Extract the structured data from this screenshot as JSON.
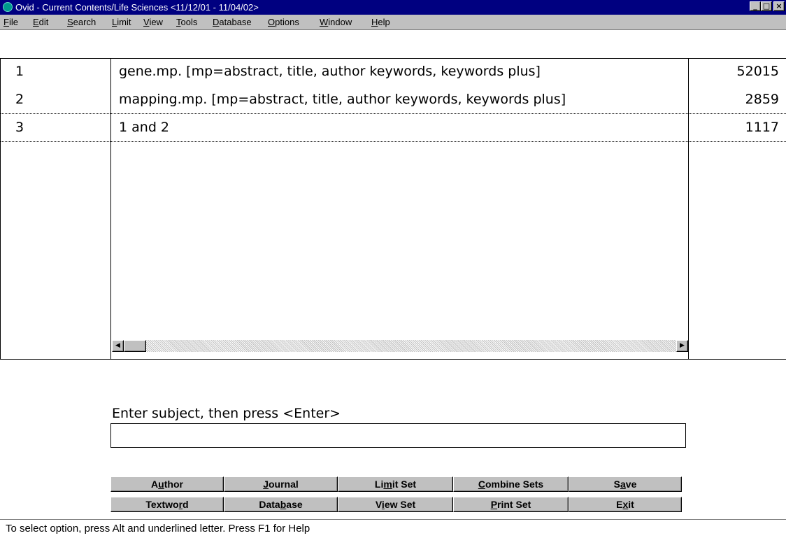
{
  "window": {
    "title": "Ovid - Current Contents/Life Sciences <11/12/01 - 11/04/02>",
    "minimize": "_",
    "maximize": "□",
    "close": "×"
  },
  "menu": [
    {
      "pre": "",
      "u": "F",
      "post": "ile"
    },
    {
      "pre": "",
      "u": "E",
      "post": "dit"
    },
    {
      "pre": "",
      "u": "S",
      "post": "earch"
    },
    {
      "pre": "",
      "u": "L",
      "post": "imit"
    },
    {
      "pre": "",
      "u": "V",
      "post": "iew"
    },
    {
      "pre": "",
      "u": "T",
      "post": "ools"
    },
    {
      "pre": "",
      "u": "D",
      "post": "atabase"
    },
    {
      "pre": "",
      "u": "O",
      "post": "ptions"
    },
    {
      "pre": "",
      "u": "W",
      "post": "indow"
    },
    {
      "pre": "",
      "u": "H",
      "post": "elp"
    }
  ],
  "history": [
    {
      "num": "1",
      "query": "gene.mp. [mp=abstract, title, author keywords, keywords plus]",
      "count": "52015"
    },
    {
      "num": "2",
      "query": "mapping.mp. [mp=abstract, title, author keywords, keywords plus]",
      "count": "2859"
    },
    {
      "num": "3",
      "query": "1 and 2",
      "count": "1117"
    }
  ],
  "scrollbar": {
    "left_arrow": "◀",
    "right_arrow": "▶"
  },
  "prompt": "Enter subject, then press <Enter>",
  "input_value": "",
  "buttons_row1": [
    {
      "pre": "A",
      "u": "u",
      "post": "thor"
    },
    {
      "pre": "",
      "u": "J",
      "post": "ournal"
    },
    {
      "pre": "Li",
      "u": "m",
      "post": "it Set"
    },
    {
      "pre": "",
      "u": "C",
      "post": "ombine Sets"
    },
    {
      "pre": "S",
      "u": "a",
      "post": "ve"
    }
  ],
  "buttons_row2": [
    {
      "pre": "Textwo",
      "u": "r",
      "post": "d"
    },
    {
      "pre": "Data",
      "u": "b",
      "post": "ase"
    },
    {
      "pre": "V",
      "u": "i",
      "post": "ew Set"
    },
    {
      "pre": "",
      "u": "P",
      "post": "rint Set"
    },
    {
      "pre": "E",
      "u": "x",
      "post": "it"
    }
  ],
  "status": "To select option, press Alt and underlined letter.  Press F1 for Help"
}
